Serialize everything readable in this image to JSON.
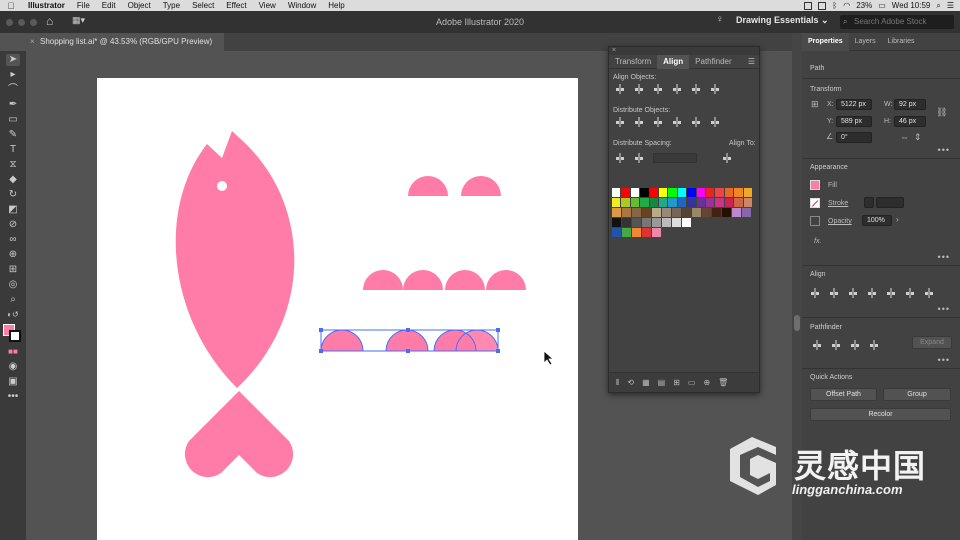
{
  "menubar": {
    "items": [
      "Illustrator",
      "File",
      "Edit",
      "Object",
      "Type",
      "Select",
      "Effect",
      "View",
      "Window",
      "Help"
    ],
    "battery": "23%",
    "clock": "Wed 10:59"
  },
  "appbar": {
    "title": "Adobe Illustrator 2020",
    "workspace": "Drawing Essentials",
    "search_placeholder": "Search Adobe Stock"
  },
  "document": {
    "tab_label": "Shopping list.ai* @ 43.53% (RGB/GPU Preview)"
  },
  "align_panel": {
    "tabs": [
      "Transform",
      "Align",
      "Pathfinder"
    ],
    "active_tab": "Align",
    "align_objects_label": "Align Objects:",
    "distribute_objects_label": "Distribute Objects:",
    "distribute_spacing_label": "Distribute Spacing:",
    "align_to_label": "Align To:",
    "swatch_rows": [
      [
        "#ffffff",
        "#ff0000",
        "#ffffff",
        "#000000",
        "#ff0000",
        "#ffff00",
        "#00ff00",
        "#00ffff",
        "#0000ff",
        "#ff00ff",
        "#ee2222",
        "#ee4444",
        "#ee6622",
        "#ee8822",
        "#eeaa22"
      ],
      [
        "#eeee22",
        "#aacc22",
        "#66bb33",
        "#22aa44",
        "#118844",
        "#22aa88",
        "#2299cc",
        "#2266bb",
        "#333399",
        "#663399",
        "#993399",
        "#cc3388",
        "#cc2255",
        "#cc6644",
        "#cc8866"
      ],
      [
        "#dd9944",
        "#aa7744",
        "#886644",
        "#664422",
        "#bbaa88",
        "#998877",
        "#776655",
        "#554433",
        "#998866",
        "#664433",
        "#442211",
        "#221100",
        "#bb88cc",
        "#8866aa"
      ],
      [
        "#111111",
        "#333333",
        "#555555",
        "#777777",
        "#999999",
        "#bbbbbb",
        "#dddddd",
        "#ffffff"
      ],
      [
        "#2255aa",
        "#44aa44",
        "#ee8833",
        "#dd3333",
        "#ee88aa"
      ]
    ]
  },
  "properties": {
    "tabs": [
      "Properties",
      "Layers",
      "Libraries"
    ],
    "active_tab": "Properties",
    "path_label": "Path",
    "transform_label": "Transform",
    "x_label": "X:",
    "x_value": "5122 px",
    "y_label": "Y:",
    "y_value": "589 px",
    "w_label": "W:",
    "w_value": "92 px",
    "h_label": "H:",
    "h_value": "46 px",
    "angle_value": "0°",
    "appearance_label": "Appearance",
    "fill_label": "Fill",
    "stroke_label": "Stroke",
    "opacity_label": "Opacity",
    "opacity_value": "100%",
    "fx_label": "fx.",
    "align_label": "Align",
    "pathfinder_label": "Pathfinder",
    "expand_label": "Expand",
    "quick_actions_label": "Quick Actions",
    "offset_path_label": "Offset Path",
    "group_label": "Group",
    "recolor_label": "Recolor"
  },
  "colors": {
    "accent_pink": "#ff7ca8",
    "selection_blue": "#4a6cf7"
  },
  "watermark": {
    "brand_cn": "灵感中国",
    "url": "lingganchina.com"
  }
}
